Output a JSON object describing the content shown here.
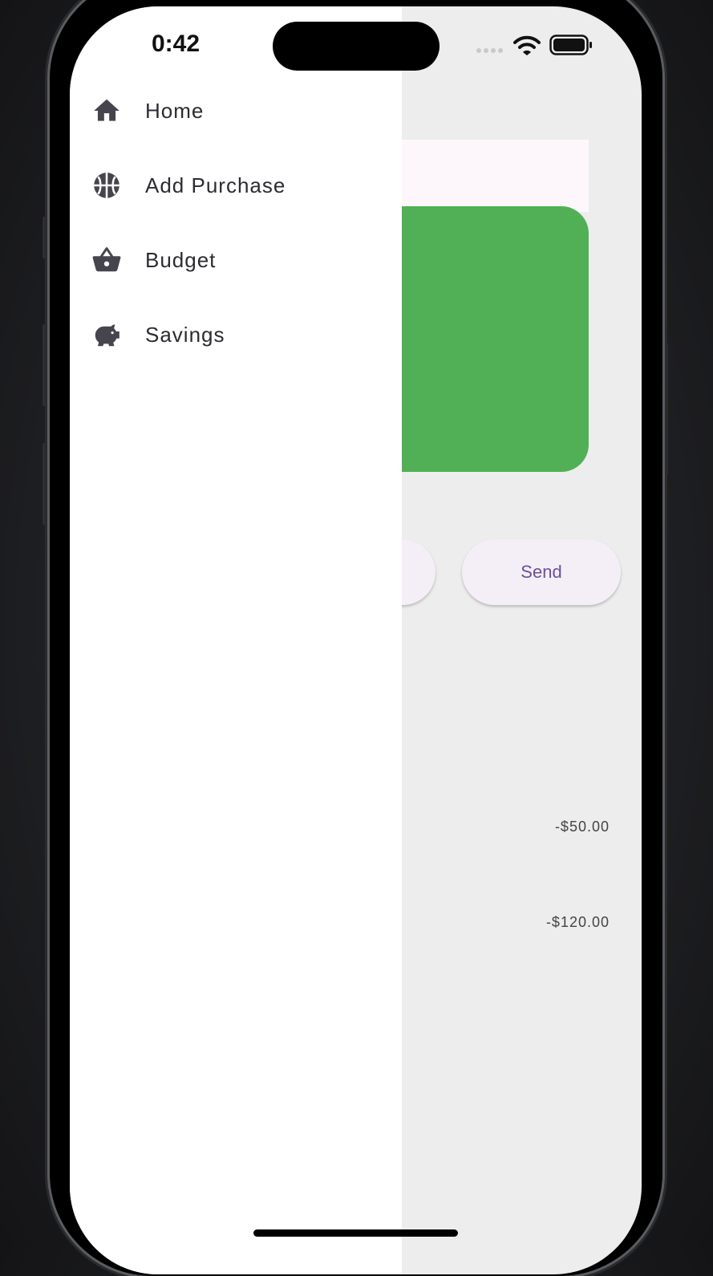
{
  "status_bar": {
    "time": "0:42"
  },
  "drawer": {
    "items": [
      {
        "label": "Home",
        "icon": "home-icon"
      },
      {
        "label": "Add Purchase",
        "icon": "basketball-icon"
      },
      {
        "label": "Budget",
        "icon": "shopping-basket-icon"
      },
      {
        "label": "Savings",
        "icon": "piggy-bank-icon"
      }
    ]
  },
  "background": {
    "send_label": "Send",
    "transactions": [
      {
        "amount": "-$50.00"
      },
      {
        "amount": "-$120.00"
      }
    ],
    "card_color": "#51b055"
  },
  "colors": {
    "icon": "#46444c",
    "text": "#2d2b31",
    "accent": "#6a4fa0"
  }
}
